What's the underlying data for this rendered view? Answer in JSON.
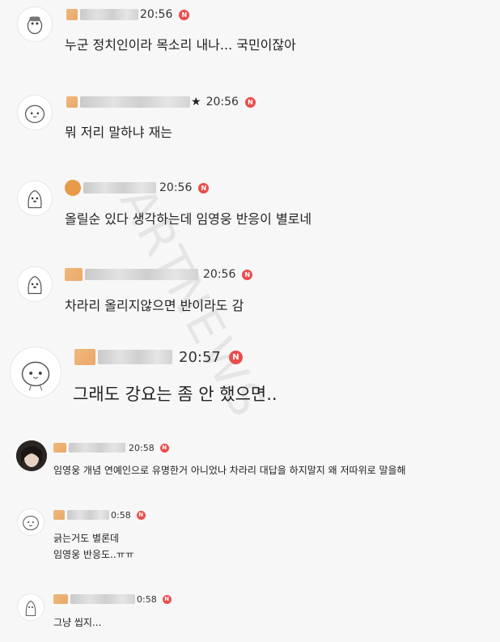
{
  "watermark": "ARTNEWS",
  "colors": {
    "background": "#f7f7f7",
    "naver_badge": "#ea4d4d",
    "text": "#222222"
  },
  "comments": [
    {
      "time": "20:56",
      "text": "누군 정치인이라 목소리 내나... 국민이잖아",
      "avatar": "character-avatar-icon"
    },
    {
      "time": "20:56",
      "text": "뭐 저리 말하냐 재는",
      "avatar": "character-avatar-icon",
      "name_suffix": "★"
    },
    {
      "time": "20:56",
      "text": "올릴순 있다 생각하는데 임영웅 반응이 별로네",
      "avatar": "character-avatar-icon"
    },
    {
      "time": "20:56",
      "text": "차라리 올리지않으면 반이라도 감",
      "avatar": "character-avatar-icon"
    },
    {
      "time": "20:57",
      "text": "그래도 강요는 좀 안 했으면..",
      "avatar": "character-avatar-icon"
    },
    {
      "time": "20:58",
      "text": "임영웅 개념 연예인으로 유명한거 아니었나 차라리 대답을 하지말지 왜 저따위로 말을해",
      "avatar": "profile-photo-avatar"
    },
    {
      "time": "0:58",
      "text": "긁는거도 별론데",
      "text2": "임영웅 반응도..ㅠㅠ",
      "avatar": "character-avatar-icon"
    },
    {
      "time": "0:58",
      "text": "그냥 씹지...",
      "avatar": "character-avatar-icon"
    }
  ],
  "badge_letter": "N"
}
